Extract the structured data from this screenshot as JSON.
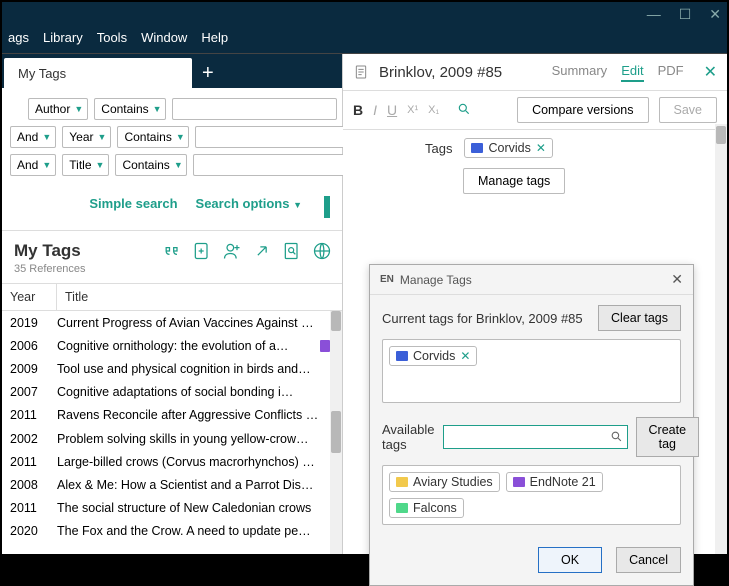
{
  "window": {
    "min": "—",
    "max": "☐",
    "close": "✕"
  },
  "menus": [
    "ags",
    "Library",
    "Tools",
    "Window",
    "Help"
  ],
  "tab": {
    "label": "My Tags",
    "add": "+"
  },
  "search": {
    "rows": [
      {
        "bool": "",
        "field": "Author",
        "op": "Contains"
      },
      {
        "bool": "And",
        "field": "Year",
        "op": "Contains"
      },
      {
        "bool": "And",
        "field": "Title",
        "op": "Contains"
      }
    ],
    "simple": "Simple search",
    "options": "Search options"
  },
  "lib": {
    "title": "My Tags",
    "count": "35 References"
  },
  "columns": {
    "year": "Year",
    "title": "Title"
  },
  "refs": [
    {
      "year": "2019",
      "title": "Current Progress of Avian Vaccines Against …",
      "tags": [
        "#f2c94c"
      ]
    },
    {
      "year": "2006",
      "title": "Cognitive ornithology: the evolution of a…",
      "tags": [
        "#8a4fd8",
        "#4fd88a"
      ]
    },
    {
      "year": "2009",
      "title": "Tool use and physical cognition in birds and…",
      "tags": [
        "#f2c94c"
      ]
    },
    {
      "year": "2007",
      "title": "Cognitive adaptations of social bonding i…",
      "tags": [
        "#8a4fd8"
      ]
    },
    {
      "year": "2011",
      "title": "Ravens Reconcile after Aggressive Conflicts …",
      "tags": [
        "#f2c94c"
      ]
    },
    {
      "year": "2002",
      "title": "Problem solving skills in young yellow-crow…",
      "tags": [
        "#8a4fd8"
      ]
    },
    {
      "year": "2011",
      "title": "Large-billed crows (Corvus macrorhynchos) …",
      "tags": [
        "#8a4fd8"
      ]
    },
    {
      "year": "2008",
      "title": "Alex & Me: How a Scientist and a Parrot Dis…",
      "tags": [
        "#8a4fd8"
      ]
    },
    {
      "year": "2011",
      "title": "The social structure of New Caledonian crows",
      "tags": [
        "#f2c94c"
      ]
    },
    {
      "year": "2020",
      "title": "The Fox and the Crow. A need to update pe…",
      "tags": [
        "#f2c94c"
      ]
    }
  ],
  "detail": {
    "title": "Brinklov, 2009 #85",
    "tabs": {
      "summary": "Summary",
      "edit": "Edit",
      "pdf": "PDF"
    },
    "fmt": {
      "b": "B",
      "i": "I",
      "u": "U",
      "sup": "X¹",
      "sub": "X₁"
    },
    "compare": "Compare versions",
    "save": "Save",
    "tags_label": "Tags",
    "current_tag": {
      "label": "Corvids",
      "color": "#3b5fd8"
    },
    "manage": "Manage tags"
  },
  "dialog": {
    "brand": "EN",
    "title": "Manage Tags",
    "current_label": "Current tags for Brinklov, 2009 #85",
    "clear": "Clear tags",
    "tag": {
      "label": "Corvids",
      "color": "#3b5fd8"
    },
    "available_label": "Available tags",
    "search_placeholder": "",
    "create": "Create tag",
    "available": [
      {
        "label": "Aviary Studies",
        "color": "#f2c94c"
      },
      {
        "label": "EndNote 21",
        "color": "#8a4fd8"
      },
      {
        "label": "Falcons",
        "color": "#4fd88a"
      }
    ],
    "ok": "OK",
    "cancel": "Cancel"
  }
}
